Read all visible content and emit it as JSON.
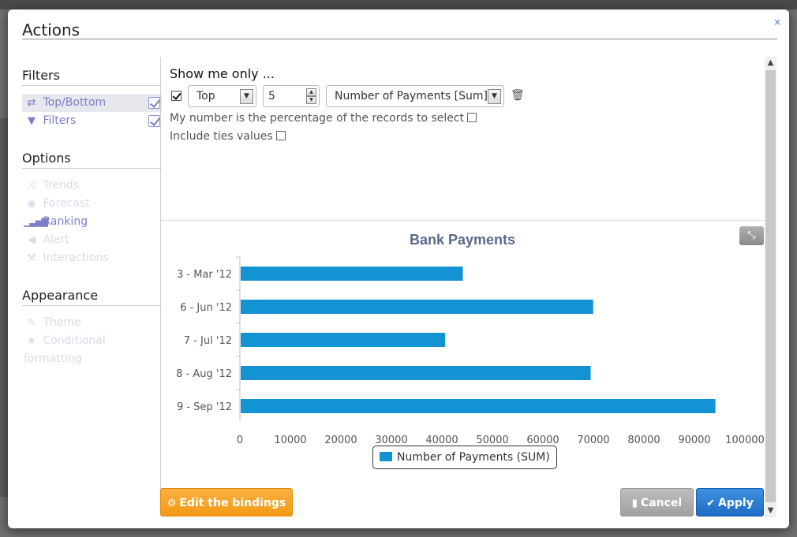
{
  "dialog": {
    "title": "Actions",
    "close_label": "×"
  },
  "nav": {
    "sections": [
      {
        "title": "Filters",
        "items": [
          {
            "label": "Top/Bottom",
            "icon": "swap-arrows-icon",
            "checked": true
          },
          {
            "label": "Filters",
            "icon": "funnel-icon",
            "checked": true
          }
        ]
      },
      {
        "title": "Options",
        "items": [
          {
            "label": "Trends",
            "icon": "shuffle-icon"
          },
          {
            "label": "Forecast",
            "icon": "eye-icon"
          },
          {
            "label": "Ranking",
            "icon": "signal-bars-icon"
          },
          {
            "label": "Alert",
            "icon": "megaphone-icon"
          },
          {
            "label": "Interactions",
            "icon": "gavel-icon"
          }
        ]
      },
      {
        "title": "Appearance",
        "items": [
          {
            "label": "Theme",
            "icon": "magic-wand-icon"
          },
          {
            "label": "Conditional formatting",
            "icon": "star-icon"
          }
        ]
      }
    ]
  },
  "topbottom": {
    "heading": "Show me only ...",
    "enabled": true,
    "direction": "Top",
    "count": "5",
    "measure": "Number of Payments [Sum]",
    "percentage_label": "My number is the percentage of the records to select",
    "ties_label": "Include ties values"
  },
  "chart_data": {
    "type": "bar",
    "orientation": "horizontal",
    "title": "Bank Payments",
    "categories": [
      "3 - Mar '12",
      "6 - Jun '12",
      "7 - Jul '12",
      "8 - Aug '12",
      "9 - Sep '12"
    ],
    "series": [
      {
        "name": "Number of Payments (SUM)",
        "values": [
          44000,
          69800,
          40500,
          69300,
          94000
        ],
        "color": "#1493d4"
      }
    ],
    "xlim": [
      0,
      100000
    ],
    "ticks": [
      "0",
      "10000",
      "20000",
      "30000",
      "40000",
      "50000",
      "60000",
      "70000",
      "80000",
      "90000",
      "100000"
    ],
    "legend": "bottom-center"
  },
  "buttons": {
    "bindings": "Edit the bindings",
    "cancel": "Cancel",
    "apply": "Apply"
  },
  "colors": {
    "accent": "#7b7ec9",
    "bar": "#1493d4",
    "orange": "#f39a16",
    "apply": "#1f6cc4"
  }
}
